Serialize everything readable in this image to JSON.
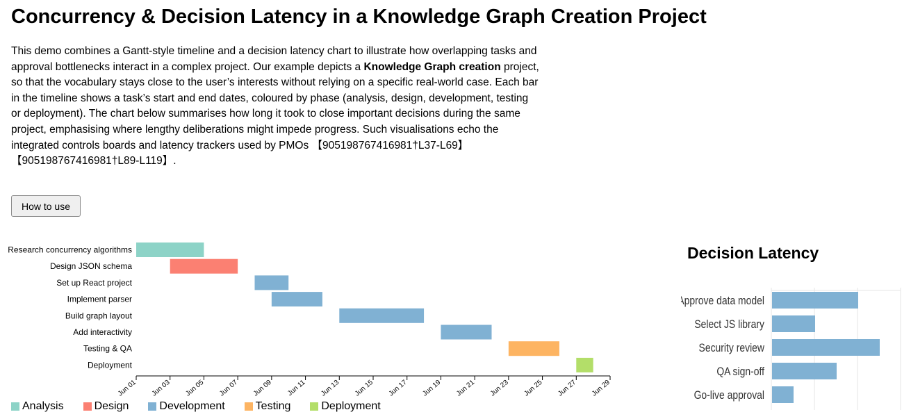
{
  "page": {
    "title": "Concurrency & Decision Latency in a Knowledge Graph Creation Project",
    "intro_part1": "This demo combines a Gantt-style timeline and a decision latency chart to illustrate how overlapping tasks and approval bottlenecks interact in a complex project. Our example depicts a ",
    "intro_bold": "Knowledge Graph creation",
    "intro_part2": " project, so that the vocabulary stays close to the user’s interests without relying on a specific real-world case. Each bar in the timeline shows a task’s start and end dates, coloured by phase (analysis, design, development, testing or deployment). The chart below summarises how long it took to close important decisions during the same project, emphasising where lengthy deliberations might impede progress. Such visualisations echo the integrated controls boards and latency trackers used by PMOs 【905198767416981†L37-L69】 【905198767416981†L89-L119】.",
    "help_button_label": "How to use",
    "latency_title": "Decision Latency"
  },
  "colors": {
    "Analysis": "#8dd3c7",
    "Design": "#fb8072",
    "Development": "#80b1d3",
    "Testing": "#fdb462",
    "Deployment": "#b3de69"
  },
  "legend": [
    "Analysis",
    "Design",
    "Development",
    "Testing",
    "Deployment"
  ],
  "chart_data": [
    {
      "type": "bar",
      "chart_kind": "gantt",
      "x_axis": "date",
      "x_ticks": [
        "Jun 01",
        "Jun 03",
        "Jun 05",
        "Jun 07",
        "Jun 09",
        "Jun 11",
        "Jun 13",
        "Jun 15",
        "Jun 17",
        "Jun 19",
        "Jun 21",
        "Jun 23",
        "Jun 25",
        "Jun 27",
        "Jun 29"
      ],
      "xlim": [
        "Jun 01",
        "Jun 29"
      ],
      "tasks": [
        {
          "name": "Research concurrency algorithms",
          "phase": "Analysis",
          "start": "Jun 01",
          "end": "Jun 05"
        },
        {
          "name": "Design JSON schema",
          "phase": "Design",
          "start": "Jun 03",
          "end": "Jun 07"
        },
        {
          "name": "Set up React project",
          "phase": "Development",
          "start": "Jun 08",
          "end": "Jun 10"
        },
        {
          "name": "Implement parser",
          "phase": "Development",
          "start": "Jun 09",
          "end": "Jun 12"
        },
        {
          "name": "Build graph layout",
          "phase": "Development",
          "start": "Jun 13",
          "end": "Jun 18"
        },
        {
          "name": "Add interactivity",
          "phase": "Development",
          "start": "Jun 19",
          "end": "Jun 22"
        },
        {
          "name": "Testing & QA",
          "phase": "Testing",
          "start": "Jun 23",
          "end": "Jun 26"
        },
        {
          "name": "Deployment",
          "phase": "Deployment",
          "start": "Jun 27",
          "end": "Jun 28"
        }
      ]
    },
    {
      "type": "bar",
      "orientation": "horizontal",
      "title": "Decision Latency",
      "categories": [
        "Approve data model",
        "Select JS library",
        "Security review",
        "QA sign-off",
        "Go-live approval"
      ],
      "values": [
        4,
        2,
        5,
        3,
        1
      ],
      "xlim": [
        0,
        6
      ],
      "grid": true,
      "color": "#80b1d3"
    }
  ]
}
